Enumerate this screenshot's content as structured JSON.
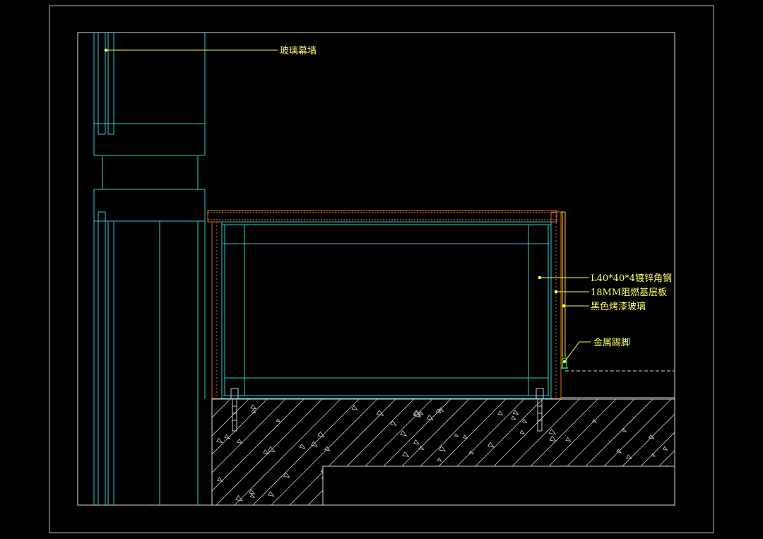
{
  "colors": {
    "background": "#000000",
    "frame": "#d8d8d8",
    "cyan": "#33cccc",
    "orange": "#e07020",
    "leader": "#ffff33",
    "green": "#33ff66",
    "hatch": "#cfcfcf"
  },
  "labels": {
    "glass_curtain_wall": "玻璃幕墙",
    "angle_steel": "L40*40*4镀锌角钢",
    "fire_board": "18MM阻燃基层板",
    "black_glass": "黑色烤漆玻璃",
    "metal_skirting": "金属踢脚"
  }
}
